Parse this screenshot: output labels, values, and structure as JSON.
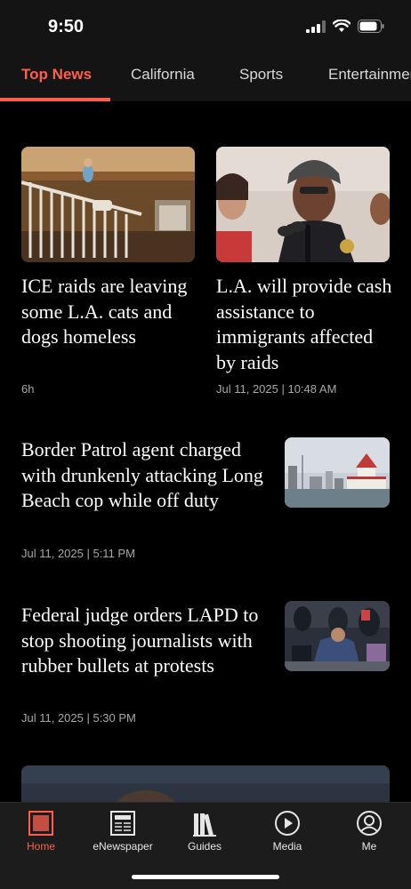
{
  "status": {
    "time": "9:50"
  },
  "tabs": [
    {
      "label": "Top News",
      "active": true
    },
    {
      "label": "California",
      "active": false
    },
    {
      "label": "Sports",
      "active": false
    },
    {
      "label": "Entertainment",
      "active": false
    }
  ],
  "articles": [
    {
      "headline": "ICE raids are leaving some L.A. cats and dogs homeless",
      "meta": "6h",
      "image_icon": "shelter-photo"
    },
    {
      "headline": "L.A. will provide cash assistance to immigrants affected by raids",
      "meta": "Jul 11, 2025 | 10:48 AM",
      "image_icon": "press-conference-photo"
    },
    {
      "headline": "Border Patrol agent charged with drunkenly attacking Long Beach cop while off duty",
      "meta": "Jul 11, 2025 | 5:11 PM",
      "image_icon": "long-beach-photo"
    },
    {
      "headline": "Federal judge orders LAPD to stop shooting journalists with rubber bullets at protests",
      "meta": "Jul 11, 2025 | 5:30 PM",
      "image_icon": "protest-photo"
    }
  ],
  "bottom_nav": [
    {
      "label": "Home",
      "icon": "home-icon",
      "active": true
    },
    {
      "label": "eNewspaper",
      "icon": "newspaper-icon",
      "active": false
    },
    {
      "label": "Guides",
      "icon": "guides-icon",
      "active": false
    },
    {
      "label": "Media",
      "icon": "play-icon",
      "active": false
    },
    {
      "label": "Me",
      "icon": "profile-icon",
      "active": false
    }
  ],
  "colors": {
    "accent": "#ff5e4d",
    "background": "#000000",
    "bar": "#141414"
  }
}
